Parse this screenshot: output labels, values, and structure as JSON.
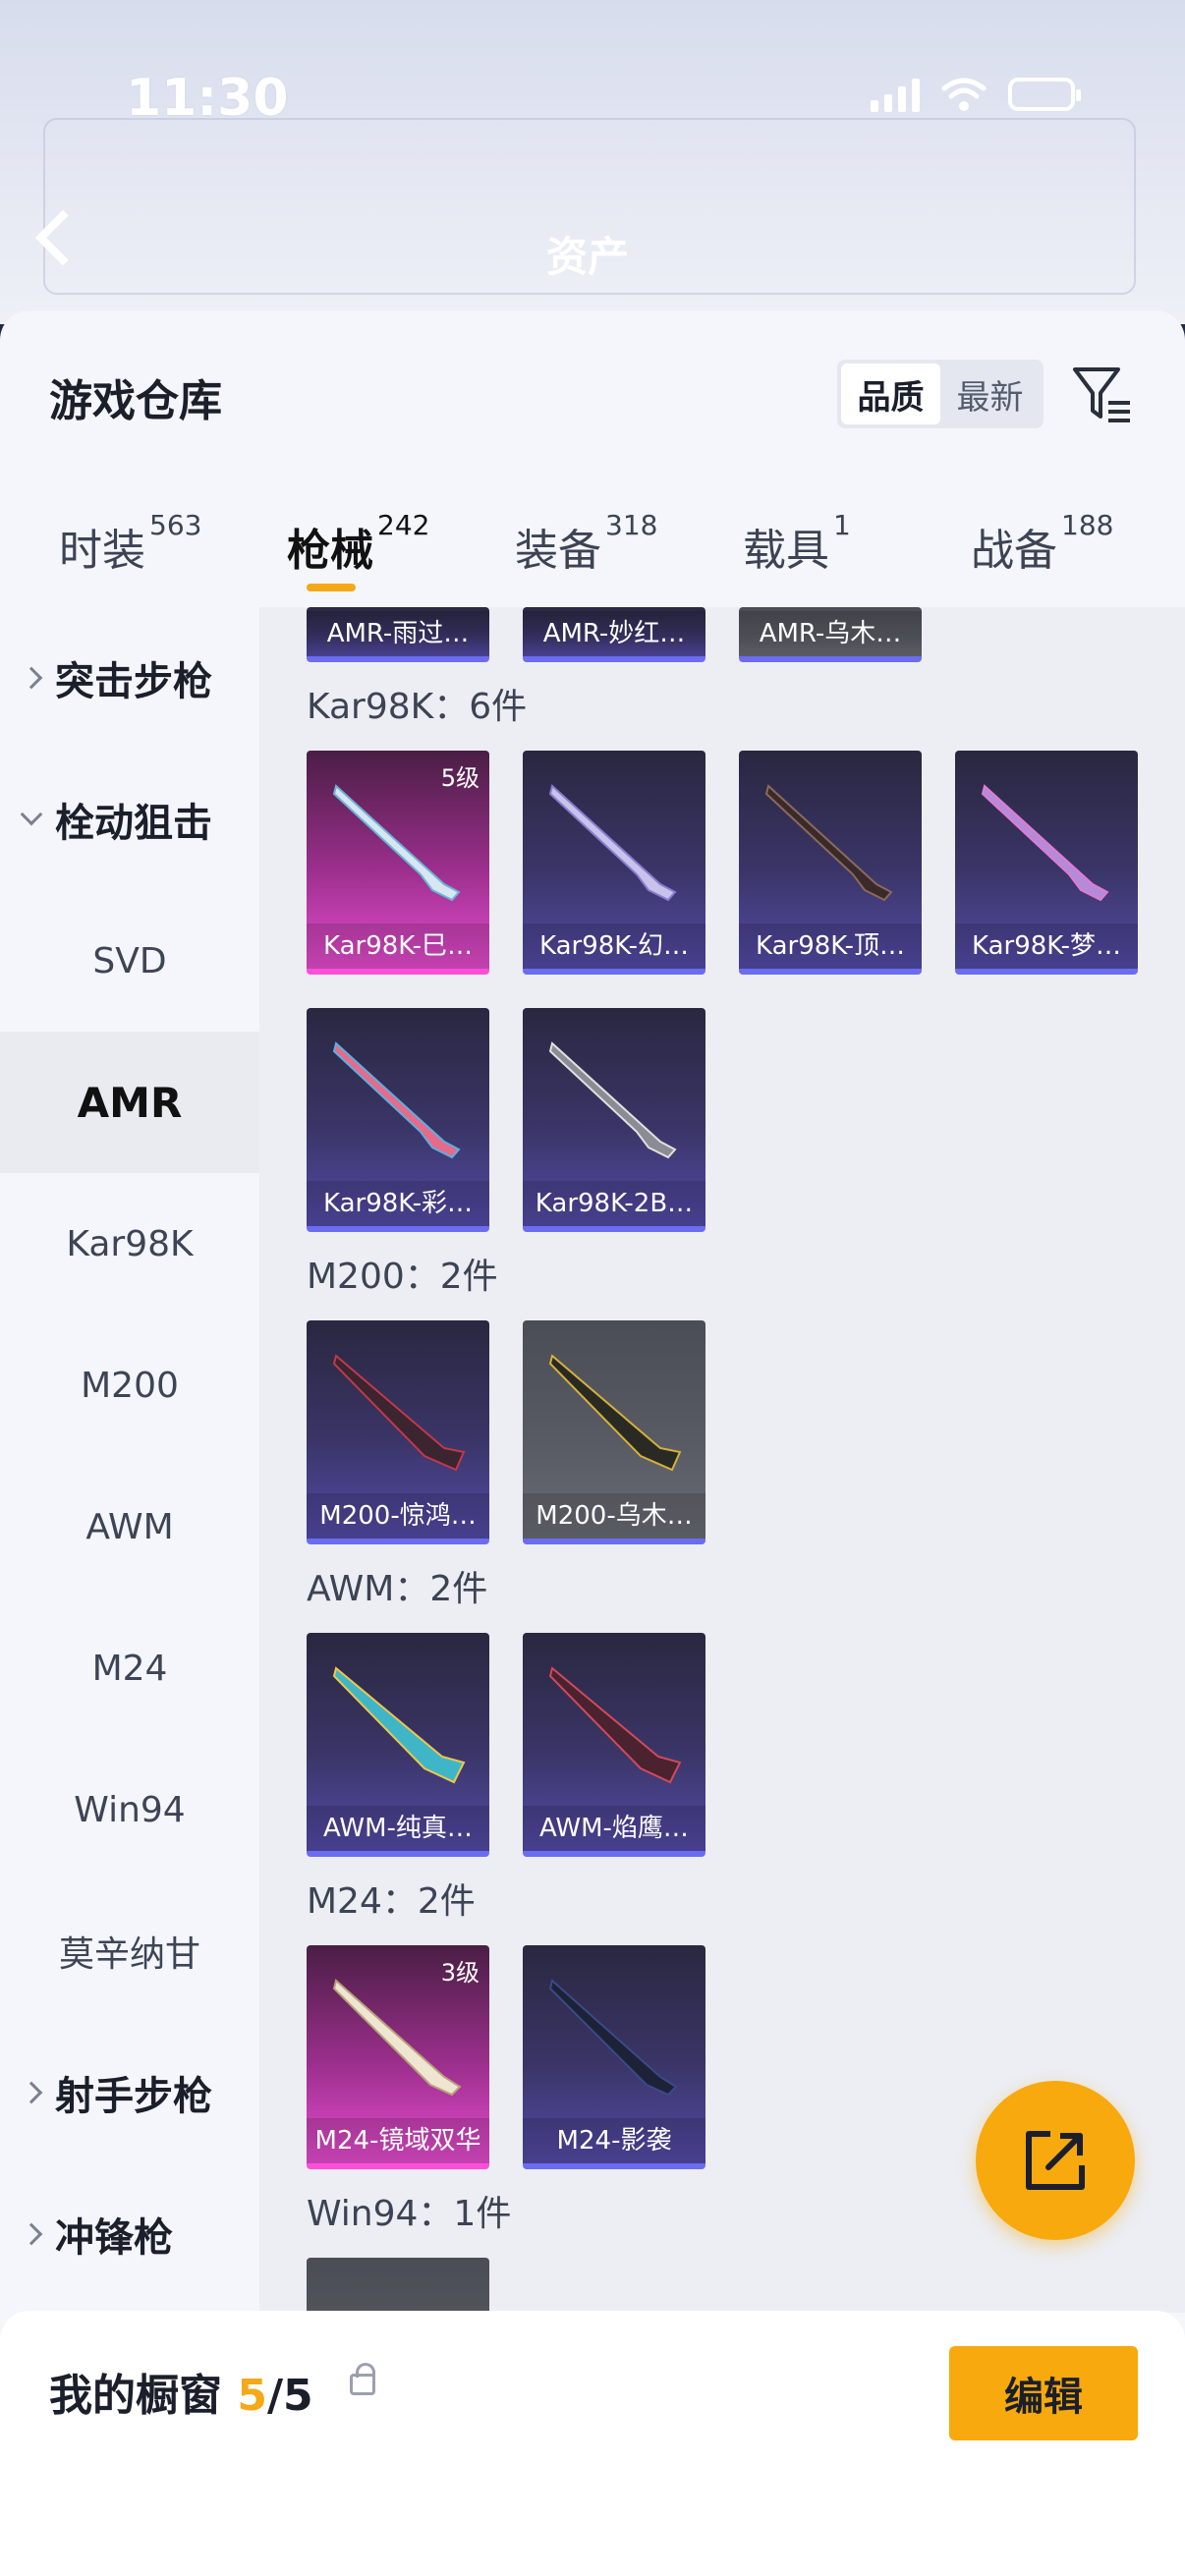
{
  "status_bar": {
    "time": "11:30"
  },
  "background_header": {
    "title": "资产"
  },
  "panel": {
    "title": "游戏仓库",
    "sort_options": [
      "品质",
      "最新"
    ],
    "sort_selected": "品质"
  },
  "tabs": [
    {
      "label": "时装",
      "count": "563"
    },
    {
      "label": "枪械",
      "count": "242",
      "active": true
    },
    {
      "label": "装备",
      "count": "318"
    },
    {
      "label": "载具",
      "count": "1"
    },
    {
      "label": "战备",
      "count": "188"
    }
  ],
  "sidebar": [
    {
      "label": "突击步枪",
      "type": "category",
      "expanded": false
    },
    {
      "label": "栓动狙击",
      "type": "category",
      "expanded": true
    },
    {
      "label": "SVD",
      "type": "item"
    },
    {
      "label": "AMR",
      "type": "item",
      "active": true
    },
    {
      "label": "Kar98K",
      "type": "item"
    },
    {
      "label": "M200",
      "type": "item"
    },
    {
      "label": "AWM",
      "type": "item"
    },
    {
      "label": "M24",
      "type": "item"
    },
    {
      "label": "Win94",
      "type": "item"
    },
    {
      "label": "莫辛纳甘",
      "type": "item"
    },
    {
      "label": "射手步枪",
      "type": "category",
      "expanded": false
    },
    {
      "label": "冲锋枪",
      "type": "category",
      "expanded": false
    }
  ],
  "groups": {
    "amr_partial": [
      {
        "name": "AMR-雨过…",
        "rarity": "purple"
      },
      {
        "name": "AMR-妙红…",
        "rarity": "purple"
      },
      {
        "name": "AMR-乌木…",
        "rarity": "grey"
      }
    ],
    "kar98k": {
      "title": "Kar98K：6件",
      "items": [
        {
          "name": "Kar98K-巳…",
          "rarity": "pink",
          "level": "5级"
        },
        {
          "name": "Kar98K-幻…",
          "rarity": "purple"
        },
        {
          "name": "Kar98K-顶…",
          "rarity": "purple"
        },
        {
          "name": "Kar98K-梦…",
          "rarity": "purple"
        },
        {
          "name": "Kar98K-彩…",
          "rarity": "purple"
        },
        {
          "name": "Kar98K-2B…",
          "rarity": "purple"
        }
      ]
    },
    "m200": {
      "title": "M200：2件",
      "items": [
        {
          "name": "M200-惊鸿…",
          "rarity": "purple"
        },
        {
          "name": "M200-乌木…",
          "rarity": "grey"
        }
      ]
    },
    "awm": {
      "title": "AWM：2件",
      "items": [
        {
          "name": "AWM-纯真…",
          "rarity": "purple"
        },
        {
          "name": "AWM-焰鹰…",
          "rarity": "purple"
        }
      ]
    },
    "m24": {
      "title": "M24：2件",
      "items": [
        {
          "name": "M24-镜域双华",
          "rarity": "pink",
          "level": "3级"
        },
        {
          "name": "M24-影袭",
          "rarity": "purple"
        }
      ]
    },
    "win94": {
      "title": "Win94：1件"
    }
  },
  "bottom": {
    "title": "我的橱窗",
    "count": "5",
    "total": "/5",
    "edit_label": "编辑"
  },
  "colors": {
    "accent": "#f7a90d",
    "purple_card": "#544ba8",
    "pink_card": "#e64dd0",
    "grey_card": "#5a5c65"
  }
}
